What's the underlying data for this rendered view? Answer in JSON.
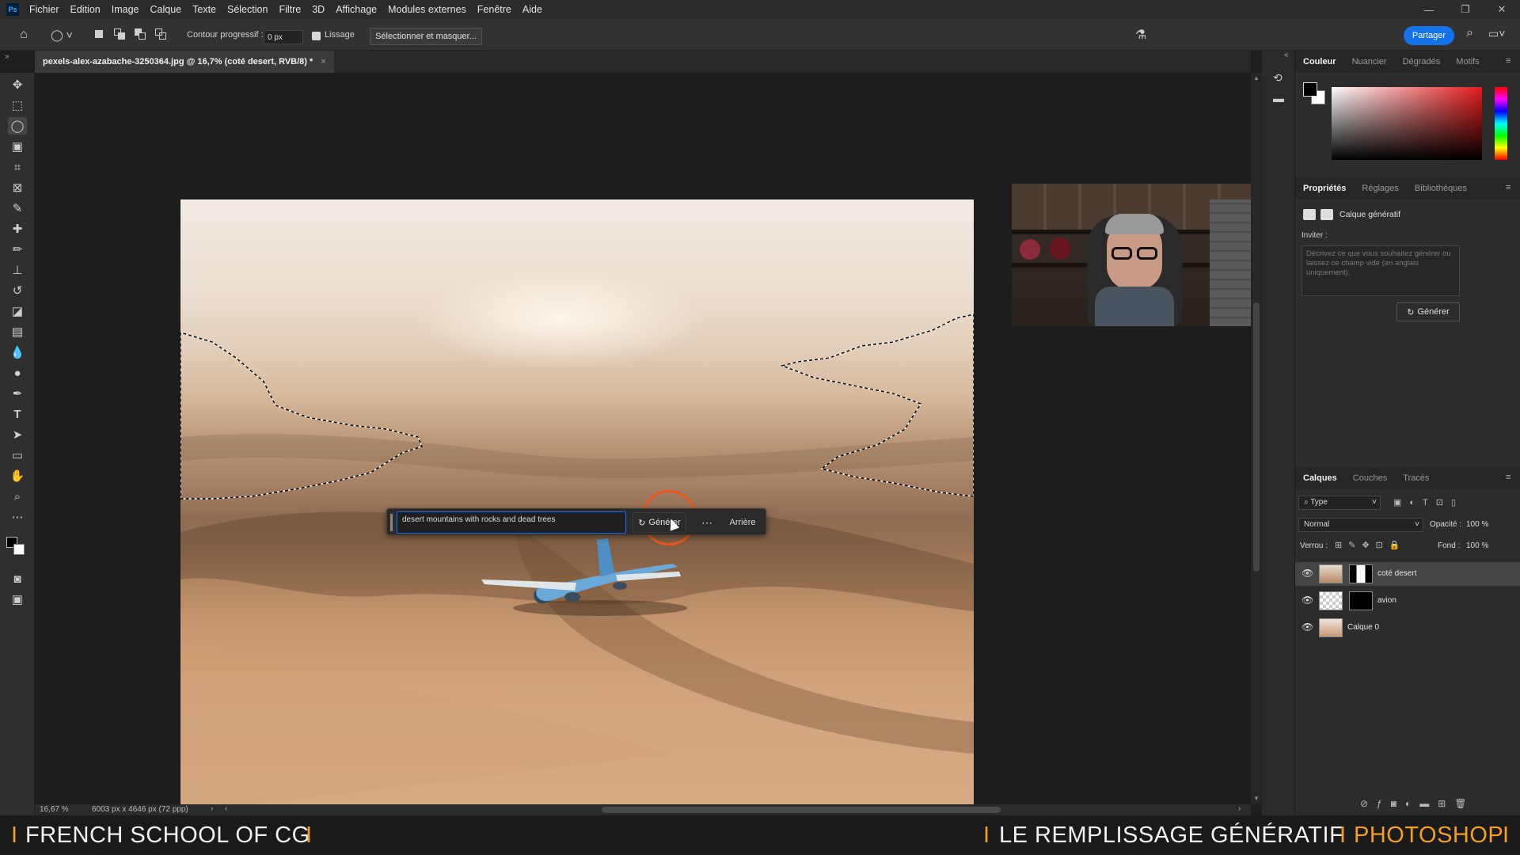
{
  "menubar": {
    "logo": "Ps",
    "items": [
      "Fichier",
      "Edition",
      "Image",
      "Calque",
      "Texte",
      "Sélection",
      "Filtre",
      "3D",
      "Affichage",
      "Modules externes",
      "Fenêtre",
      "Aide"
    ]
  },
  "options_bar": {
    "feather_label": "Contour progressif :",
    "feather_value": "0 px",
    "smooth_label": "Lissage",
    "smooth_checked": true,
    "select_mask_label": "Sélectionner et masquer...",
    "share_label": "Partager"
  },
  "document": {
    "tab_title": "pexels-alex-azabache-3250364.jpg @ 16,7% (coté desert, RVB/8) *",
    "close_glyph": "×"
  },
  "contextual_bar": {
    "prompt_value": "desert mountains with rocks and dead trees",
    "generate_label": "Générer",
    "more_glyph": "⋯",
    "back_label": "Arrière"
  },
  "status_bar": {
    "zoom": "16,67 %",
    "doc_info": "6003 px x 4646 px (72 ppp)"
  },
  "color_panel": {
    "tabs": [
      "Couleur",
      "Nuancier",
      "Dégradés",
      "Motifs"
    ],
    "active_tab": "Couleur",
    "foreground": "#000000",
    "background": "#ffffff"
  },
  "properties_panel": {
    "tabs": [
      "Propriétés",
      "Réglages",
      "Bibliothèques"
    ],
    "active_tab": "Propriétés",
    "layer_type": "Calque génératif",
    "prompt_label": "Inviter :",
    "prompt_placeholder": "Décrivez ce que vous souhaitez générer ou laissez ce champ vide (en anglais uniquement).",
    "generate_label": "Générer"
  },
  "layers_panel": {
    "tabs": [
      "Calques",
      "Couches",
      "Tracés"
    ],
    "active_tab": "Calques",
    "filter_label": "Type",
    "blend_mode": "Normal",
    "opacity_label": "Opacité :",
    "opacity_value": "100 %",
    "lock_label": "Verrou :",
    "fill_label": "Fond :",
    "fill_value": "100 %",
    "layers": [
      {
        "name": "coté desert",
        "selected": true
      },
      {
        "name": "avion",
        "selected": false
      },
      {
        "name": "Calque 0",
        "selected": false
      }
    ]
  },
  "caption": {
    "left": "FRENCH SCHOOL OF CG",
    "right_1": "LE REMPLISSAGE GÉNÉRATIF",
    "right_2": "PHOTOSHOP",
    "separator": "I"
  },
  "colors": {
    "accent": "#1473e6",
    "brand_orange": "#f29e1e",
    "click_ring": "#e8571e"
  }
}
